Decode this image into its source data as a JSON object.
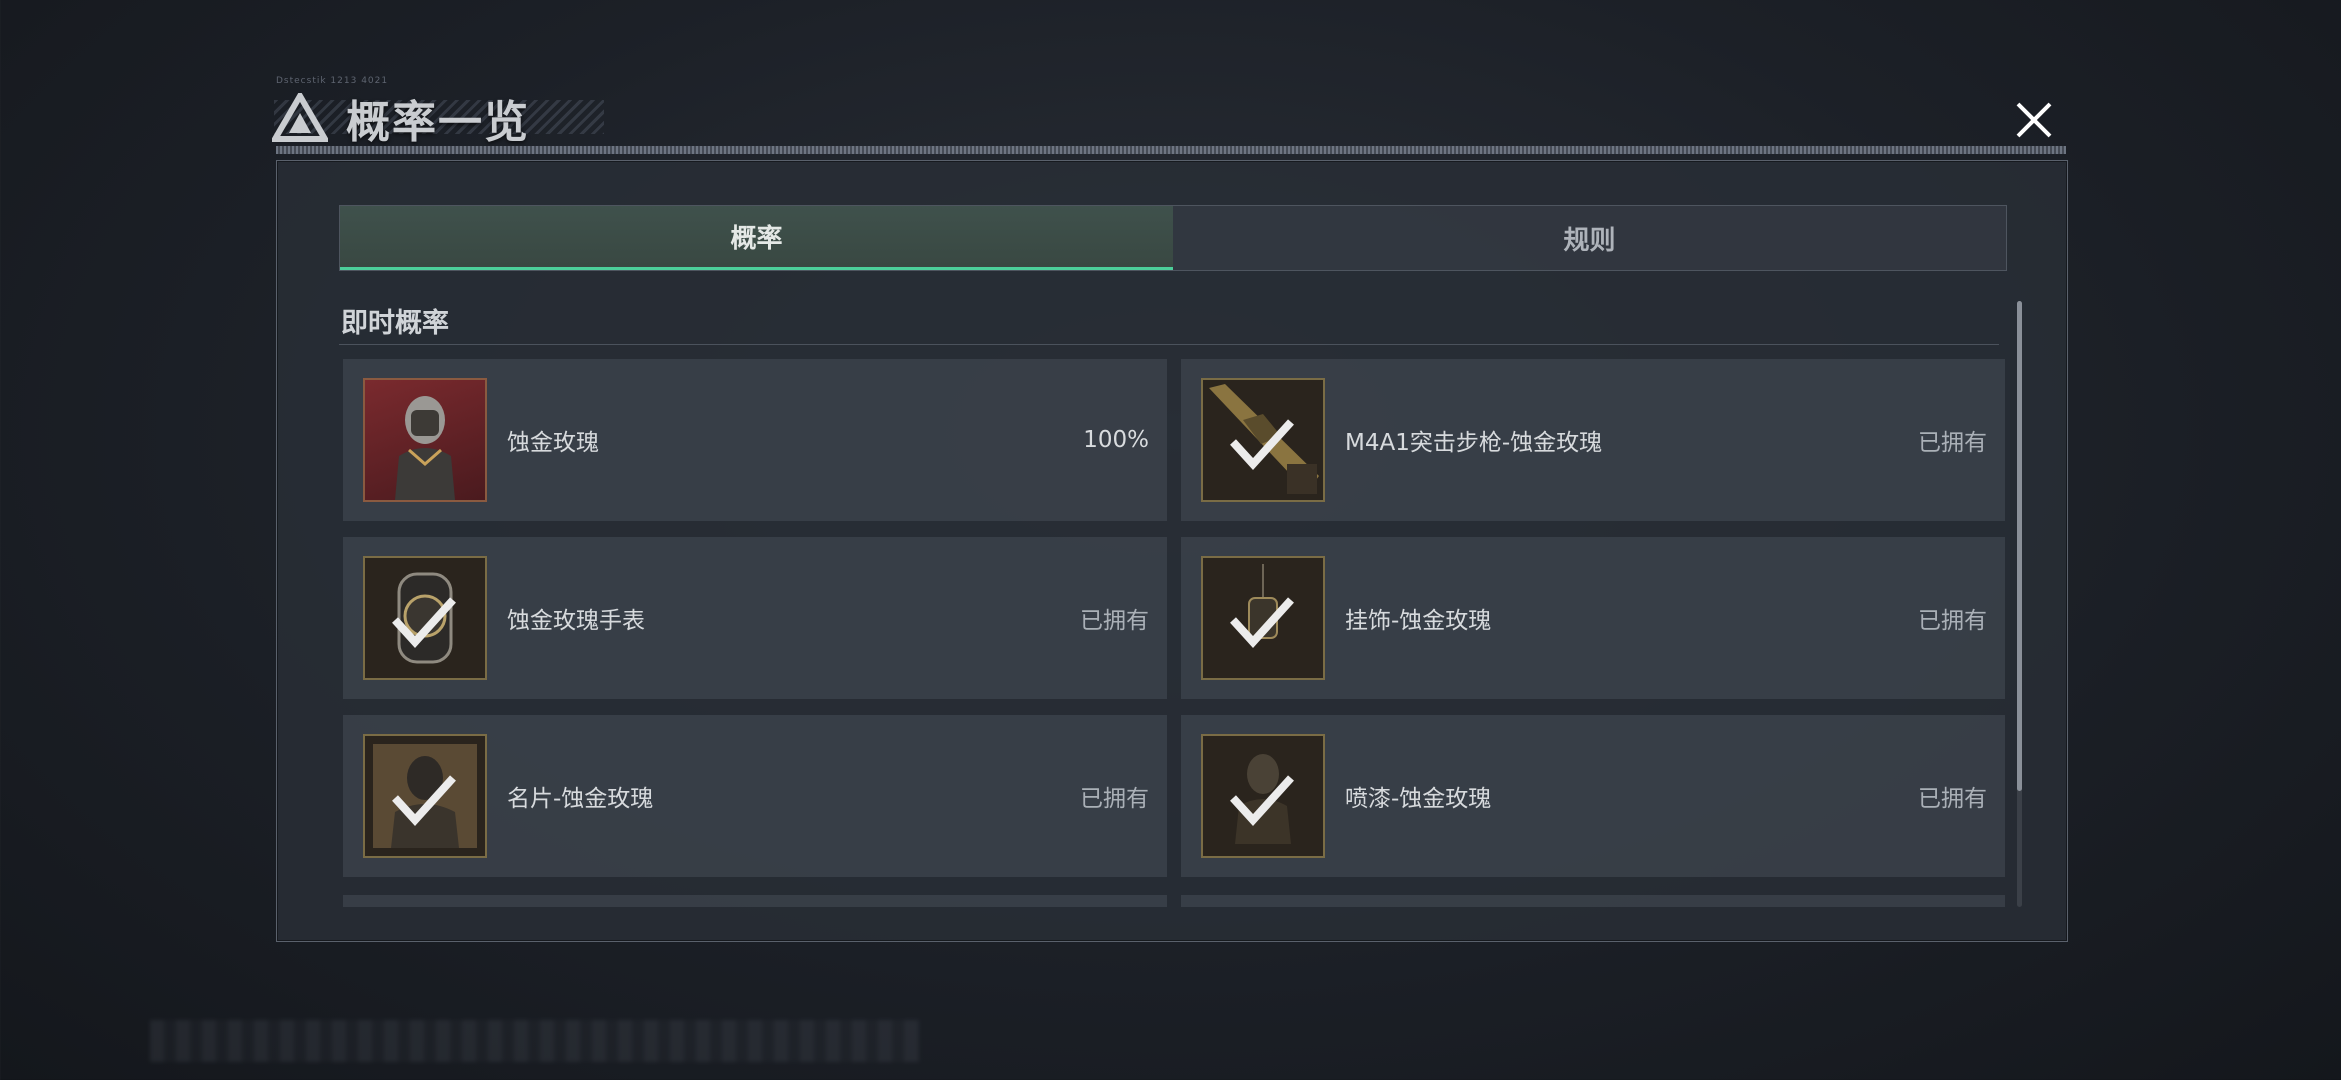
{
  "header": {
    "title": "概率一览",
    "micro_text": "Dstecstik 1213 4021"
  },
  "tabs": [
    {
      "label": "概率",
      "active": true
    },
    {
      "label": "规则",
      "active": false
    }
  ],
  "section": {
    "title": "即时概率"
  },
  "items": [
    {
      "name": "蚀金玫瑰",
      "status": "100%",
      "owned": false,
      "icon": "operator-portrait-icon"
    },
    {
      "name": "M4A1突击步枪-蚀金玫瑰",
      "status": "已拥有",
      "owned": true,
      "icon": "rifle-icon"
    },
    {
      "name": "蚀金玫瑰手表",
      "status": "已拥有",
      "owned": true,
      "icon": "watch-icon"
    },
    {
      "name": "挂饰-蚀金玫瑰",
      "status": "已拥有",
      "owned": true,
      "icon": "charm-icon"
    },
    {
      "name": "名片-蚀金玫瑰",
      "status": "已拥有",
      "owned": true,
      "icon": "name-card-icon"
    },
    {
      "name": "喷漆-蚀金玫瑰",
      "status": "已拥有",
      "owned": true,
      "icon": "spray-icon"
    }
  ],
  "colors": {
    "accent": "#4ccf9a",
    "panel": "#2e343c",
    "text": "#d8dbde"
  }
}
